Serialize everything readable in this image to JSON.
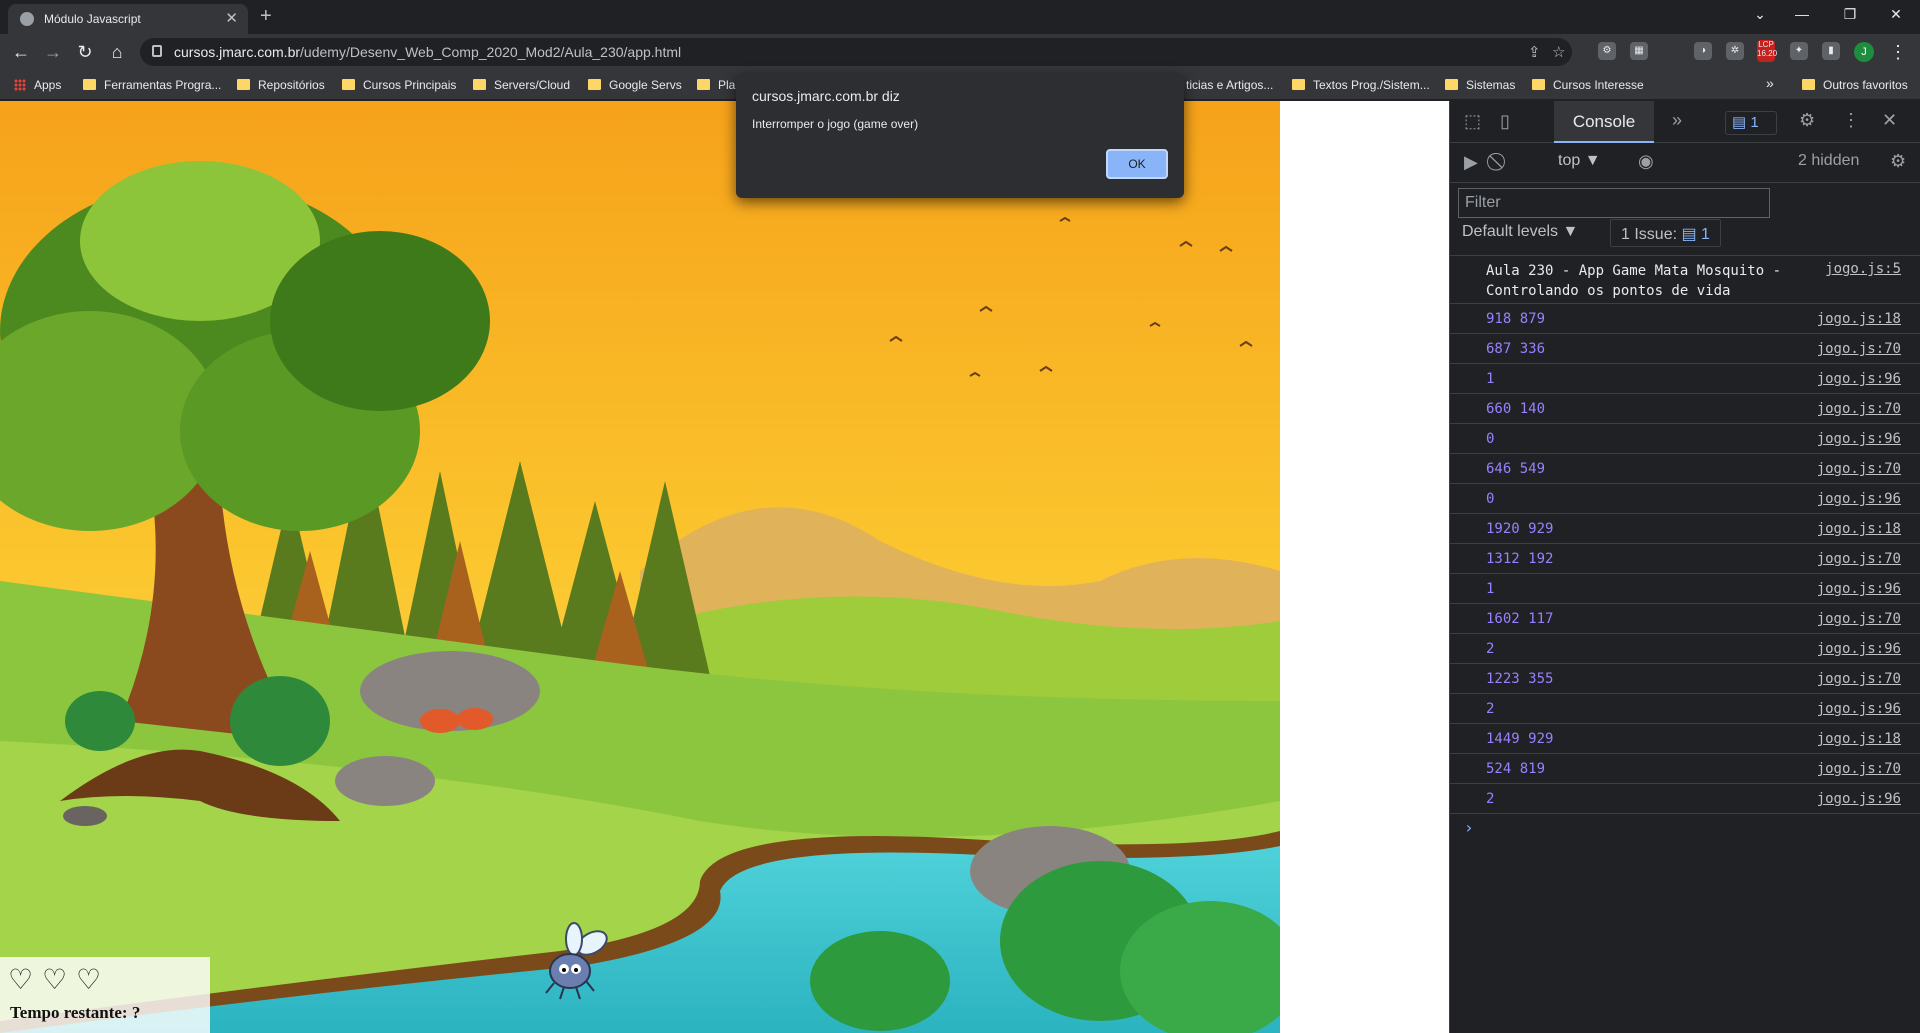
{
  "browser": {
    "tab_title": "Módulo Javascript",
    "tab_close": "✕",
    "new_tab": "+",
    "window_controls": [
      "⌄",
      "—",
      "❐",
      "✕"
    ],
    "nav": {
      "back": "←",
      "forward": "→",
      "reload": "↻",
      "home": "⌂"
    },
    "url_domain": "cursos.jmarc.com.br",
    "url_path": "/udemy/Desenv_Web_Comp_2020_Mod2/Aula_230/app.html",
    "share_icon": "⇪",
    "star_icon": "☆",
    "extensions": [
      "⚙",
      "▦",
      "◑",
      "✲",
      "LCP",
      "✦",
      "▮"
    ],
    "lcp_value": "16.20",
    "avatar_letter": "J",
    "menu_icon": "⋮"
  },
  "bookmarks": {
    "apps": "Apps",
    "items": [
      "Ferramentas Progra...",
      "Repositórios",
      "Cursos Principais",
      "Servers/Cloud",
      "Google Servs",
      "Pla"
    ],
    "items_right": [
      "ticias e Artigos...",
      "Textos Prog./Sistem...",
      "Sistemas",
      "Cursos Interesse"
    ],
    "more": "»",
    "other": "Outros favoritos"
  },
  "dialog": {
    "title": "cursos.jmarc.com.br diz",
    "message": "Interromper o jogo (game over)",
    "ok": "OK"
  },
  "game": {
    "hearts": [
      "♡",
      "♡",
      "♡"
    ],
    "timer_label": "Tempo restante: ?"
  },
  "devtools": {
    "console_tab": "Console",
    "more_tabs": "»",
    "messages_count": "1",
    "context": "top ▼",
    "hidden": "2 hidden",
    "filter_placeholder": "Filter",
    "levels": "Default levels ▼",
    "issues_label": "1 Issue:",
    "issues_count": "1",
    "prompt": "›",
    "log_rows": [
      {
        "msg": "Aula 230 - App Game Mata Mosquito - Controlando os pontos de vida",
        "src": "jogo.js:5"
      },
      {
        "msg": "918 879",
        "src": "jogo.js:18"
      },
      {
        "msg": "687 336",
        "src": "jogo.js:70"
      },
      {
        "msg": "1",
        "src": "jogo.js:96"
      },
      {
        "msg": "660 140",
        "src": "jogo.js:70"
      },
      {
        "msg": "0",
        "src": "jogo.js:96"
      },
      {
        "msg": "646 549",
        "src": "jogo.js:70"
      },
      {
        "msg": "0",
        "src": "jogo.js:96"
      },
      {
        "msg": "1920 929",
        "src": "jogo.js:18"
      },
      {
        "msg": "1312 192",
        "src": "jogo.js:70"
      },
      {
        "msg": "1",
        "src": "jogo.js:96"
      },
      {
        "msg": "1602 117",
        "src": "jogo.js:70"
      },
      {
        "msg": "2",
        "src": "jogo.js:96"
      },
      {
        "msg": "1223 355",
        "src": "jogo.js:70"
      },
      {
        "msg": "2",
        "src": "jogo.js:96"
      },
      {
        "msg": "1449 929",
        "src": "jogo.js:18"
      },
      {
        "msg": "524 819",
        "src": "jogo.js:70"
      },
      {
        "msg": "2",
        "src": "jogo.js:96"
      }
    ]
  }
}
